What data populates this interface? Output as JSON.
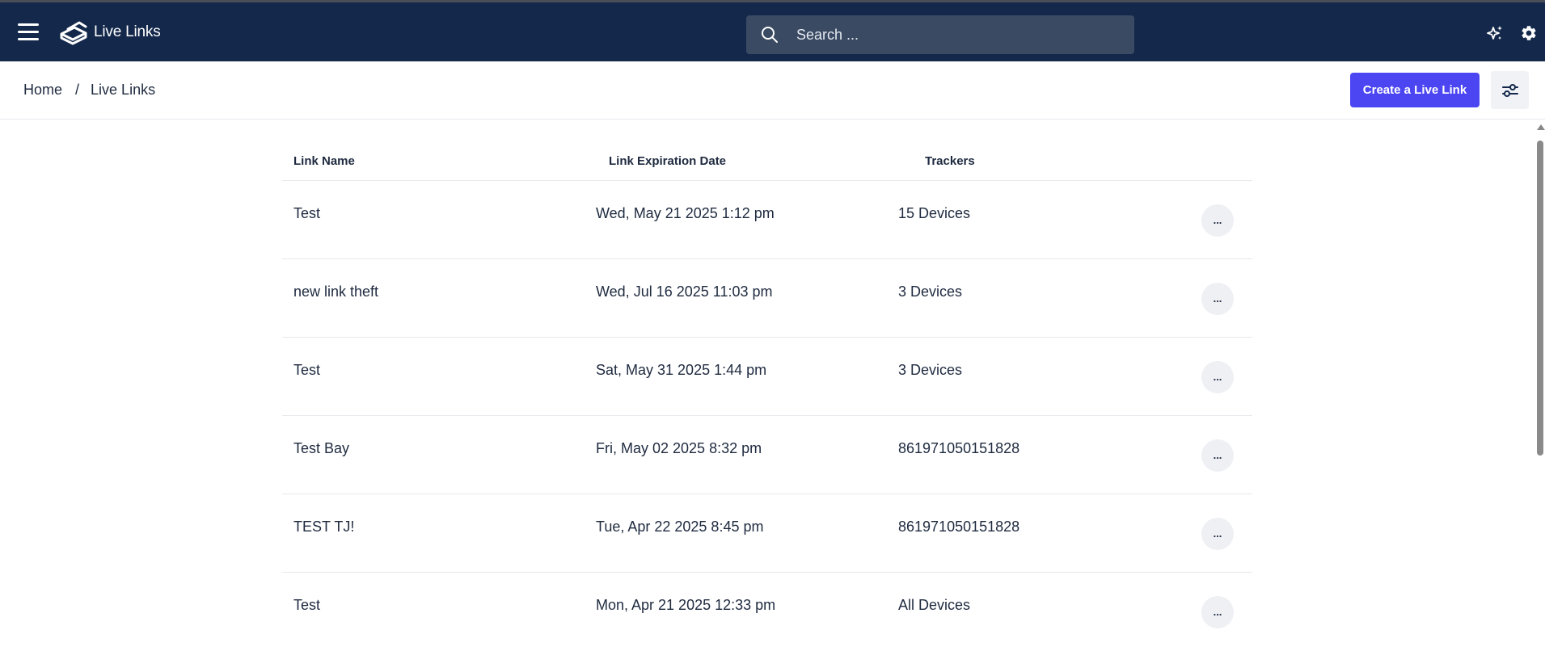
{
  "topbar": {
    "app_name": "Live Links",
    "search_placeholder": "Search ...",
    "icons": [
      "menu-icon",
      "logo-icon",
      "search-icon",
      "sparkle-icon",
      "gear-icon"
    ]
  },
  "breadcrumb": {
    "home": "Home",
    "separator": "/",
    "current": "Live Links"
  },
  "actions": {
    "create_label": "Create a Live Link",
    "accent": "#4b45f2"
  },
  "table": {
    "columns": [
      "Link Name",
      "Link Expiration Date",
      "Trackers"
    ],
    "more_label": "...",
    "rows": [
      {
        "name": "Test",
        "expires": "Wed, May 21 2025 1:12 pm",
        "trackers": "15 Devices"
      },
      {
        "name": "new link theft",
        "expires": "Wed, Jul 16 2025 11:03 pm",
        "trackers": "3 Devices"
      },
      {
        "name": "Test",
        "expires": "Sat, May 31 2025 1:44 pm",
        "trackers": "3 Devices"
      },
      {
        "name": "Test Bay",
        "expires": "Fri, May 02 2025 8:32 pm",
        "trackers": "861971050151828"
      },
      {
        "name": "TEST TJ!",
        "expires": "Tue, Apr 22 2025 8:45 pm",
        "trackers": "861971050151828"
      },
      {
        "name": "Test",
        "expires": "Mon, Apr 21 2025 12:33 pm",
        "trackers": "All Devices"
      }
    ]
  },
  "colors": {
    "topbar_bg": "#13284a",
    "search_bg": "#3a4a63"
  }
}
